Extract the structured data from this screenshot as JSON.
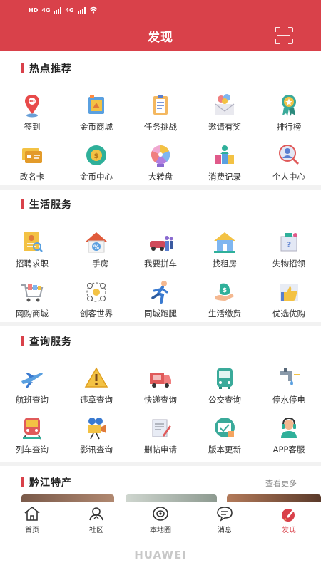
{
  "status_bar": {
    "network": "HD",
    "signal1": "4G",
    "signal2": "4G"
  },
  "header": {
    "title": "发现"
  },
  "sections": [
    {
      "title": "热点推荐",
      "items": [
        {
          "label": "签到",
          "icon": "location-checkin-icon"
        },
        {
          "label": "金币商城",
          "icon": "coin-store-icon"
        },
        {
          "label": "任务挑战",
          "icon": "task-clipboard-icon"
        },
        {
          "label": "邀请有奖",
          "icon": "invite-envelope-icon"
        },
        {
          "label": "排行榜",
          "icon": "ranking-medal-icon"
        },
        {
          "label": "改名卡",
          "icon": "rename-card-icon"
        },
        {
          "label": "金币中心",
          "icon": "coin-center-icon"
        },
        {
          "label": "大转盘",
          "icon": "prize-wheel-icon"
        },
        {
          "label": "消费记录",
          "icon": "spending-record-icon"
        },
        {
          "label": "个人中心",
          "icon": "profile-search-icon"
        }
      ]
    },
    {
      "title": "生活服务",
      "items": [
        {
          "label": "招聘求职",
          "icon": "job-resume-icon"
        },
        {
          "label": "二手房",
          "icon": "second-hand-house-icon"
        },
        {
          "label": "我要拼车",
          "icon": "carpool-icon"
        },
        {
          "label": "找租房",
          "icon": "rental-house-icon"
        },
        {
          "label": "失物招领",
          "icon": "lost-found-icon"
        },
        {
          "label": "网购商城",
          "icon": "shopping-cart-icon"
        },
        {
          "label": "创客世界",
          "icon": "maker-world-icon"
        },
        {
          "label": "同城跑腿",
          "icon": "running-errand-icon"
        },
        {
          "label": "生活缴费",
          "icon": "bill-payment-icon"
        },
        {
          "label": "优选优购",
          "icon": "thumbs-up-icon"
        }
      ]
    },
    {
      "title": "查询服务",
      "items": [
        {
          "label": "航班查询",
          "icon": "airplane-icon"
        },
        {
          "label": "违章查询",
          "icon": "warning-triangle-icon"
        },
        {
          "label": "快递查询",
          "icon": "delivery-truck-icon"
        },
        {
          "label": "公交查询",
          "icon": "bus-icon"
        },
        {
          "label": "停水停电",
          "icon": "water-tap-icon"
        },
        {
          "label": "列车查询",
          "icon": "train-icon"
        },
        {
          "label": "影讯查询",
          "icon": "movie-camera-icon"
        },
        {
          "label": "删帖申请",
          "icon": "delete-post-icon"
        },
        {
          "label": "版本更新",
          "icon": "version-update-icon"
        },
        {
          "label": "APP客服",
          "icon": "customer-service-icon"
        }
      ]
    }
  ],
  "specialty": {
    "title": "黔江特产",
    "more": "查看更多"
  },
  "tabbar": [
    {
      "label": "首页",
      "icon": "home-icon"
    },
    {
      "label": "社区",
      "icon": "community-icon"
    },
    {
      "label": "本地圈",
      "icon": "local-circle-icon"
    },
    {
      "label": "消息",
      "icon": "message-icon"
    },
    {
      "label": "发现",
      "icon": "discover-rocket-icon",
      "active": true
    }
  ],
  "brand": "HUAWEI",
  "colors": {
    "primary": "#d9414a",
    "divider": "#f2f2f2"
  }
}
